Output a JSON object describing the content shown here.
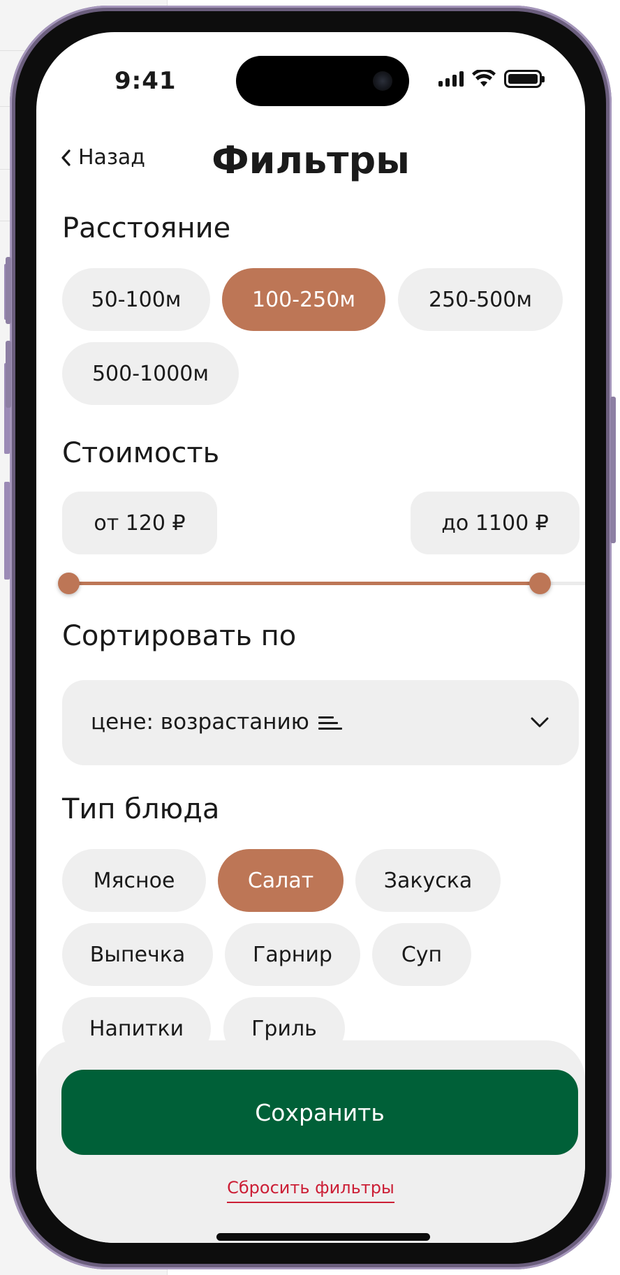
{
  "status_bar": {
    "time": "9:41"
  },
  "header": {
    "back_label": "Назад",
    "title": "Фильтры"
  },
  "distance": {
    "title": "Расстояние",
    "options": [
      "50-100м",
      "100-250м",
      "250-500м",
      "500-1000м"
    ],
    "selected": "100-250м"
  },
  "price": {
    "title": "Стоимость",
    "from_label": "от 120 ₽",
    "to_label": "до 1100 ₽",
    "range_min_fraction": 0.0,
    "range_max_fraction": 0.92
  },
  "sort": {
    "title": "Сортировать по",
    "value": "цене: возрастанию"
  },
  "dish_type": {
    "title": "Тип блюда",
    "options": [
      "Мясное",
      "Салат",
      "Закуска",
      "Выпечка",
      "Гарнир",
      "Суп",
      "Напитки",
      "Гриль"
    ],
    "selected": "Салат"
  },
  "actions": {
    "save_label": "Сохранить",
    "reset_label": "Сбросить фильтры"
  },
  "colors": {
    "accent": "#bd7656",
    "primary_button": "#006038",
    "reset_link": "#cc1f36",
    "chip_background": "#efefef"
  }
}
